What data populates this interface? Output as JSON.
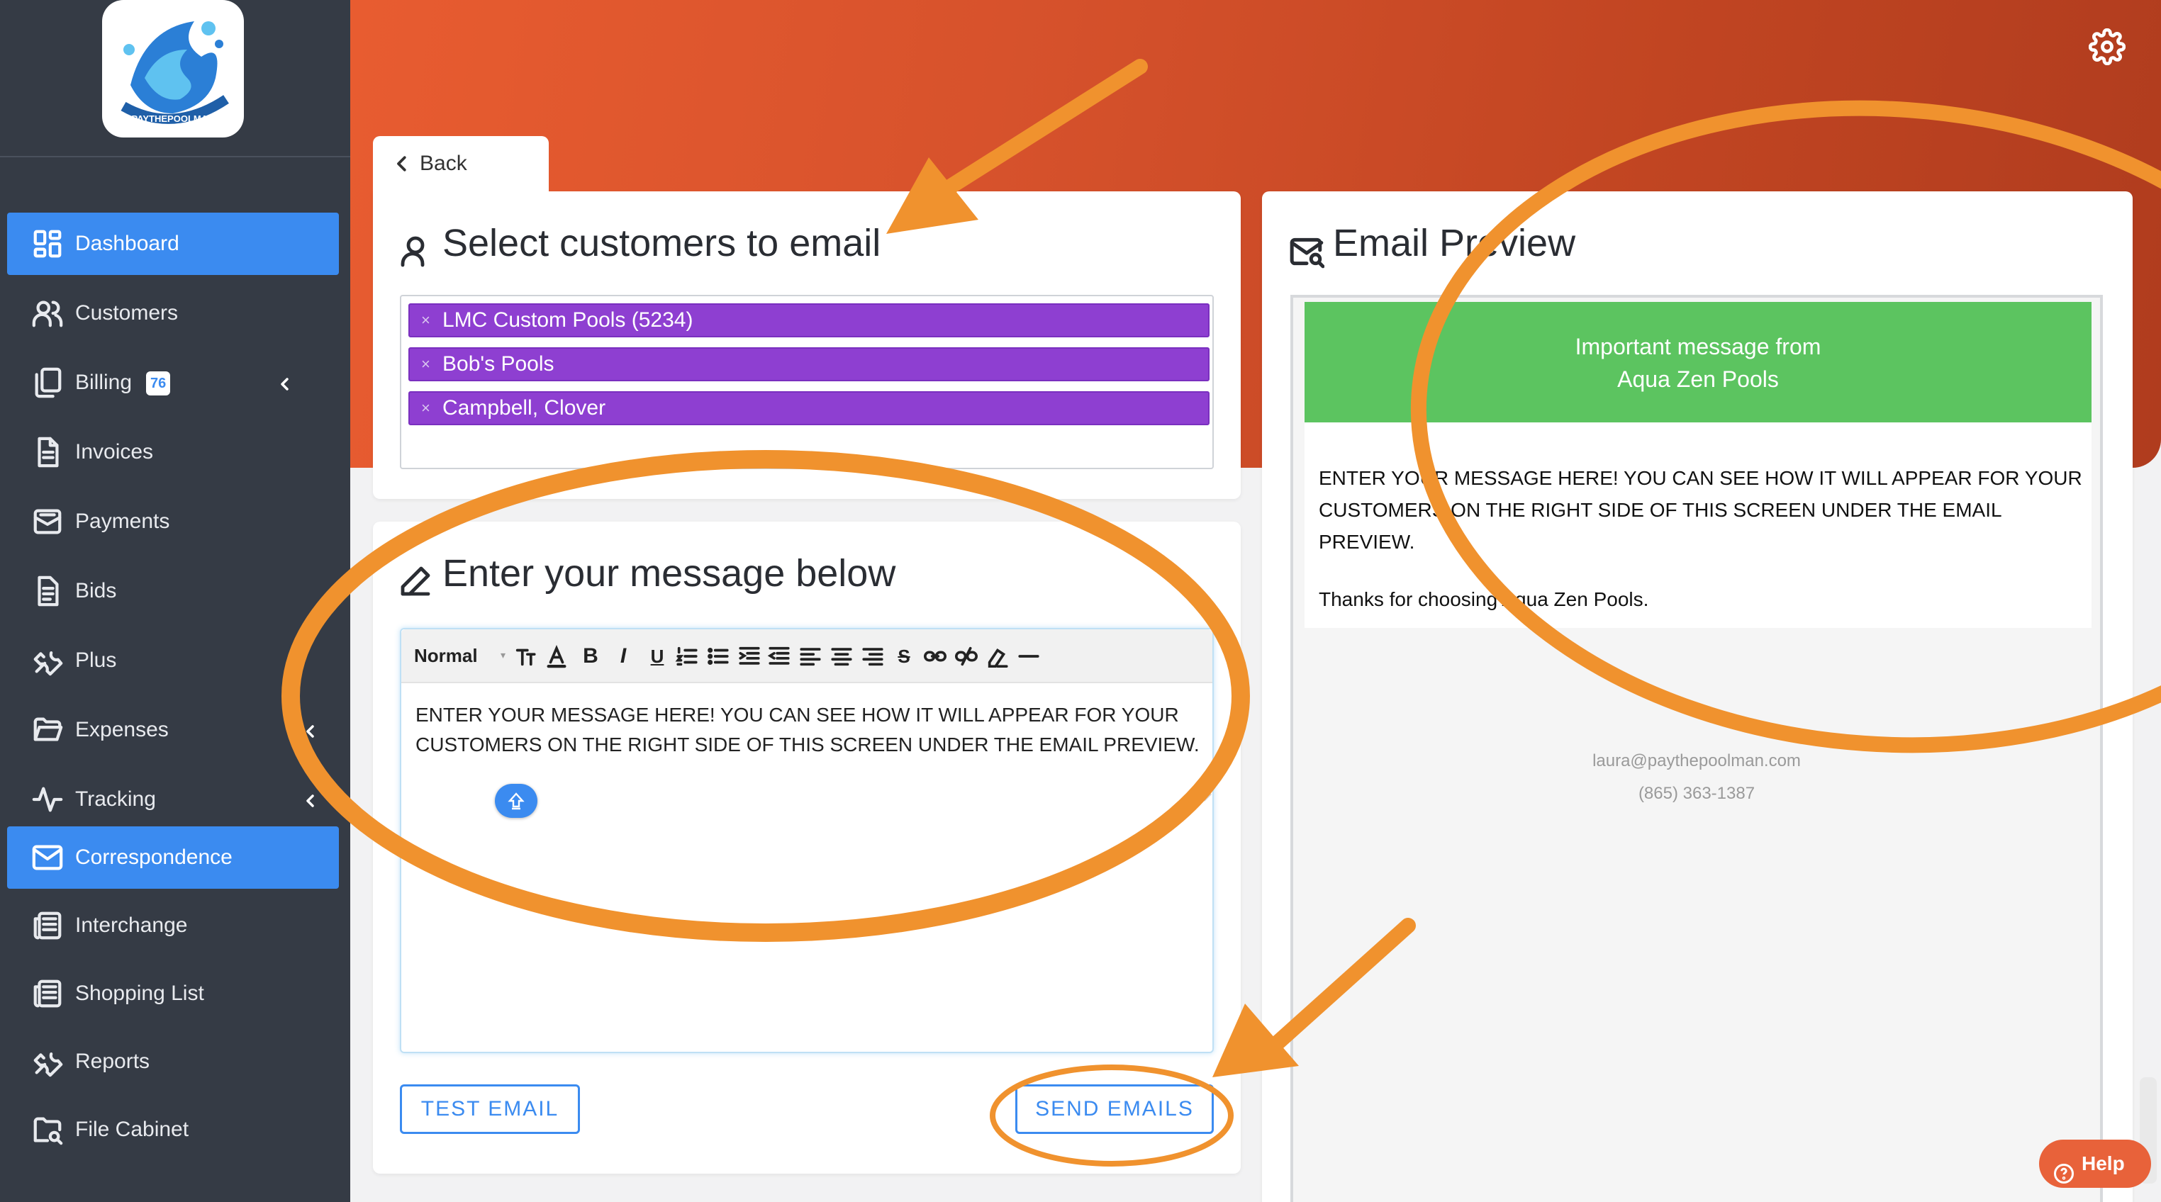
{
  "app": {
    "brand_text": "PAYTHEPOOLMAN",
    "accent_color": "#3b8bf0",
    "header_gradient": [
      "#e85c30",
      "#b03c1e"
    ],
    "chip_color": "#8e3fd1",
    "preview_header_color": "#5cc460",
    "annotation_color": "#f0922e"
  },
  "sidebar": {
    "items": [
      {
        "label": "Dashboard",
        "icon": "dashboard-grid-icon",
        "active": true
      },
      {
        "label": "Customers",
        "icon": "users-icon"
      },
      {
        "label": "Billing",
        "icon": "copy-files-icon",
        "badge": "76",
        "expandable": true
      },
      {
        "label": "Invoices",
        "icon": "document-icon"
      },
      {
        "label": "Payments",
        "icon": "envelope-open-icon"
      },
      {
        "label": "Bids",
        "icon": "document-lines-icon"
      },
      {
        "label": "Plus",
        "icon": "wrench-icon"
      },
      {
        "label": "Expenses",
        "icon": "folder-open-icon",
        "expandable": true
      },
      {
        "label": "Tracking",
        "icon": "activity-pulse-icon",
        "expandable": true
      },
      {
        "label": "Correspondence",
        "icon": "mail-icon",
        "active": true
      },
      {
        "label": "Interchange",
        "icon": "newspaper-icon"
      },
      {
        "label": "Shopping List",
        "icon": "newspaper-icon"
      },
      {
        "label": "Reports",
        "icon": "wrench-icon"
      },
      {
        "label": "File Cabinet",
        "icon": "folder-search-icon"
      }
    ]
  },
  "nav": {
    "back_label": "Back"
  },
  "select_customers": {
    "title": "Select customers to email",
    "chips": [
      "LMC Custom Pools (5234)",
      "Bob's Pools",
      "Campbell, Clover"
    ],
    "remove_glyph": "×"
  },
  "message": {
    "title": "Enter your message below",
    "format_value": "Normal",
    "body": "ENTER YOUR MESSAGE HERE! YOU CAN SEE HOW IT WILL APPEAR FOR YOUR CUSTOMERS ON THE RIGHT SIDE OF THIS SCREEN UNDER THE EMAIL PREVIEW.",
    "toolbar": {
      "bold": "B",
      "italic": "I",
      "underline": "U",
      "strike": "S"
    },
    "test_button": "TEST EMAIL",
    "send_button": "SEND EMAILS"
  },
  "preview": {
    "title": "Email Preview",
    "banner_line1": "Important message from",
    "banner_line2": "Aqua Zen Pools",
    "body": "ENTER YOUR MESSAGE HERE! YOU CAN SEE HOW IT WILL APPEAR FOR YOUR CUSTOMERS ON THE RIGHT SIDE OF THIS SCREEN UNDER THE EMAIL PREVIEW.",
    "thanks": "Thanks for choosing Aqua Zen Pools.",
    "footer_email": "laura@paythepoolman.com",
    "footer_phone": "(865) 363-1387"
  },
  "help": {
    "label": "Help"
  }
}
